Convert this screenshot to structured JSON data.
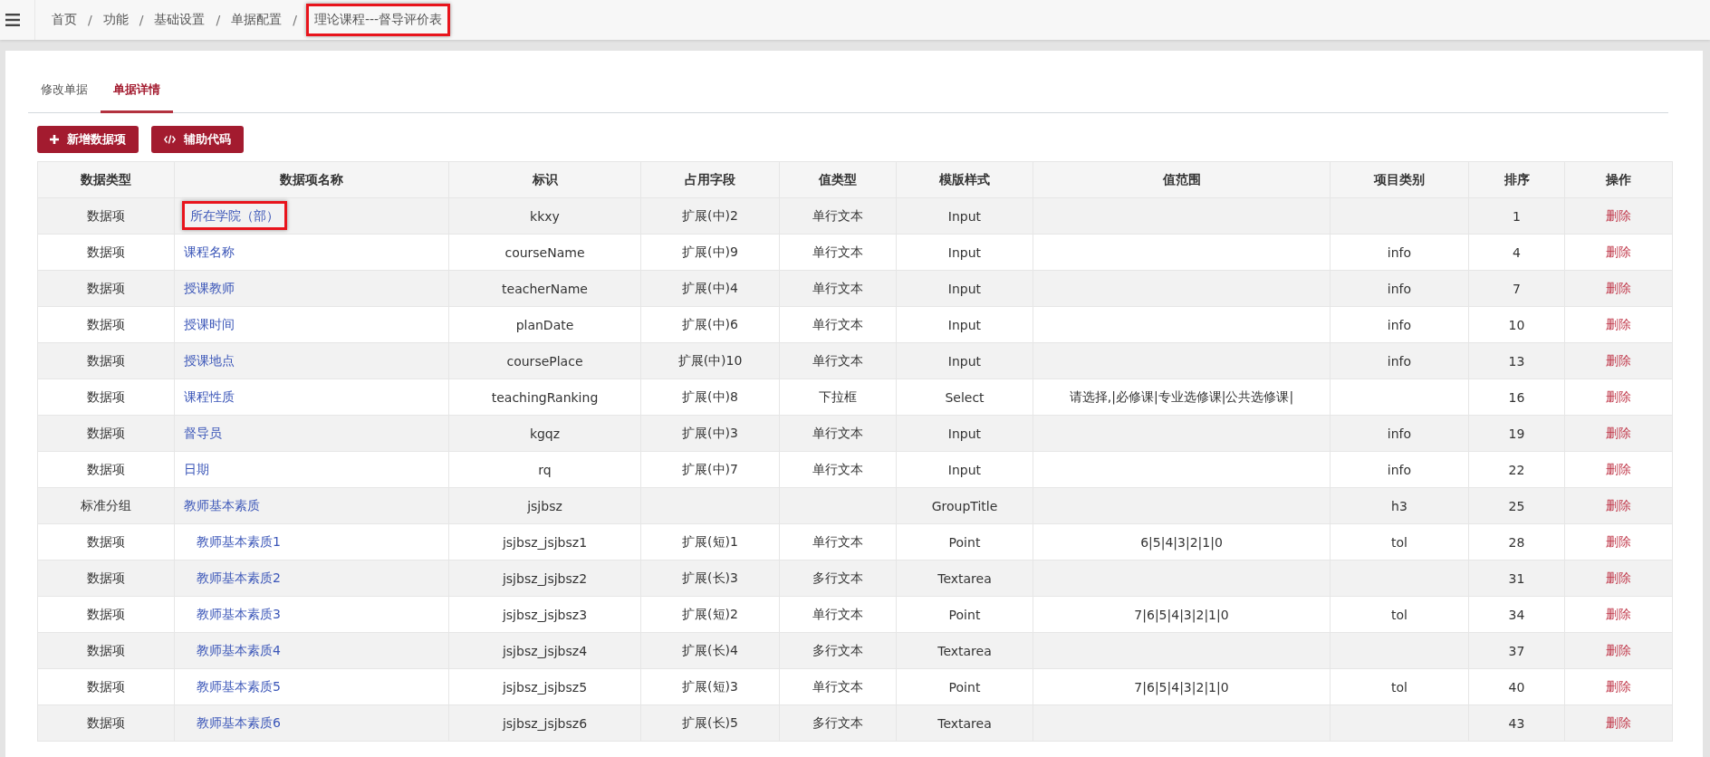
{
  "breadcrumb": [
    {
      "label": "首页",
      "highlighted": false
    },
    {
      "label": "功能",
      "highlighted": false
    },
    {
      "label": "基础设置",
      "highlighted": false
    },
    {
      "label": "单据配置",
      "highlighted": false
    },
    {
      "label": "理论课程---督导评价表",
      "highlighted": true
    }
  ],
  "breadcrumb_separator": "/",
  "tabs": [
    {
      "label": "修改单据",
      "selected": false
    },
    {
      "label": "单据详情",
      "selected": true
    }
  ],
  "buttons": [
    {
      "kind": "add",
      "label": "新增数据项"
    },
    {
      "kind": "code",
      "label": "辅助代码"
    }
  ],
  "table": {
    "columns": [
      "数据类型",
      "数据项名称",
      "标识",
      "占用字段",
      "值类型",
      "模版样式",
      "值范围",
      "项目类别",
      "排序",
      "操作"
    ],
    "rows": [
      {
        "type": "数据项",
        "name": "所在学院（部）",
        "highlighted": true,
        "key": "kkxy",
        "field": "扩展(中)2",
        "value_type": "单行文本",
        "template": "Input",
        "order": "1",
        "action": "删除"
      },
      {
        "type": "数据项",
        "name": "课程名称",
        "highlighted": false,
        "key": "courseName",
        "field": "扩展(中)9",
        "value_type": "单行文本",
        "template": "Input",
        "category": "info",
        "order": "4",
        "action": "删除"
      },
      {
        "type": "数据项",
        "name": "授课教师",
        "highlighted": false,
        "key": "teacherName",
        "field": "扩展(中)4",
        "value_type": "单行文本",
        "template": "Input",
        "category": "info",
        "order": "7",
        "action": "删除"
      },
      {
        "type": "数据项",
        "name": "授课时间",
        "highlighted": false,
        "key": "planDate",
        "field": "扩展(中)6",
        "value_type": "单行文本",
        "template": "Input",
        "category": "info",
        "order": "10",
        "action": "删除"
      },
      {
        "type": "数据项",
        "name": "授课地点",
        "highlighted": false,
        "key": "coursePlace",
        "field": "扩展(中)10",
        "value_type": "单行文本",
        "template": "Input",
        "category": "info",
        "order": "13",
        "action": "删除"
      },
      {
        "type": "数据项",
        "name": "课程性质",
        "highlighted": false,
        "key": "teachingRanking",
        "field": "扩展(中)8",
        "value_type": "下拉框",
        "template": "Select",
        "range": "请选择,|必修课|专业选修课|公共选修课|",
        "order": "16",
        "action": "删除"
      },
      {
        "type": "数据项",
        "name": "督导员",
        "highlighted": false,
        "key": "kgqz",
        "field": "扩展(中)3",
        "value_type": "单行文本",
        "template": "Input",
        "category": "info",
        "order": "19",
        "action": "删除"
      },
      {
        "type": "数据项",
        "name": "日期",
        "highlighted": false,
        "key": "rq",
        "field": "扩展(中)7",
        "value_type": "单行文本",
        "template": "Input",
        "category": "info",
        "order": "22",
        "action": "删除"
      },
      {
        "type": "标准分组",
        "name": "教师基本素质",
        "highlighted": false,
        "key": "jsjbsz",
        "template": "GroupTitle",
        "category": "h3",
        "order": "25",
        "action": "删除",
        "children": [
          {
            "type": "数据项",
            "name": "教师基本素质1",
            "highlighted": false,
            "key": "jsjbsz_jsjbsz1",
            "field": "扩展(短)1",
            "value_type": "单行文本",
            "template": "Point",
            "range": "6|5|4|3|2|1|0",
            "category": "tol",
            "order": "28",
            "action": "删除"
          },
          {
            "type": "数据项",
            "name": "教师基本素质2",
            "highlighted": false,
            "key": "jsjbsz_jsjbsz2",
            "field": "扩展(长)3",
            "value_type": "多行文本",
            "template": "Textarea",
            "order": "31",
            "action": "删除"
          },
          {
            "type": "数据项",
            "name": "教师基本素质3",
            "highlighted": false,
            "key": "jsjbsz_jsjbsz3",
            "field": "扩展(短)2",
            "value_type": "单行文本",
            "template": "Point",
            "range": "7|6|5|4|3|2|1|0",
            "category": "tol",
            "order": "34",
            "action": "删除"
          },
          {
            "type": "数据项",
            "name": "教师基本素质4",
            "highlighted": false,
            "key": "jsjbsz_jsjbsz4",
            "field": "扩展(长)4",
            "value_type": "多行文本",
            "template": "Textarea",
            "order": "37",
            "action": "删除"
          },
          {
            "type": "数据项",
            "name": "教师基本素质5",
            "highlighted": false,
            "key": "jsjbsz_jsjbsz5",
            "field": "扩展(短)3",
            "value_type": "单行文本",
            "template": "Point",
            "range": "7|6|5|4|3|2|1|0",
            "category": "tol",
            "order": "40",
            "action": "删除"
          },
          {
            "type": "数据项",
            "name": "教师基本素质6",
            "highlighted": false,
            "key": "jsjbsz_jsjbsz6",
            "field": "扩展(长)5",
            "value_type": "多行文本",
            "template": "Textarea",
            "order": "43",
            "action": "删除"
          }
        ]
      }
    ]
  }
}
